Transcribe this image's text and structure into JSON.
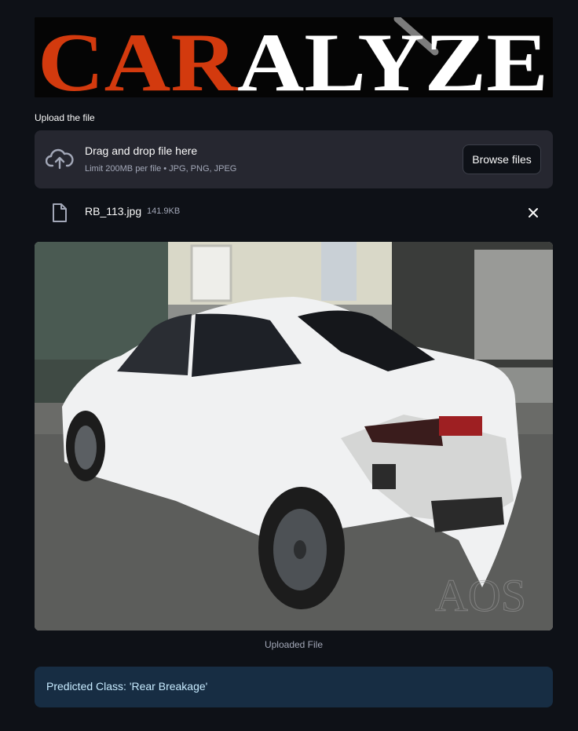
{
  "header": {
    "logo_text_left": "CAR",
    "logo_text_right": "ALYZE",
    "logo_color_left": "#d33a0e",
    "logo_color_right": "#ffffff"
  },
  "uploader": {
    "label": "Upload the file",
    "drop_title": "Drag and drop file here",
    "limit_text": "Limit 200MB per file • JPG, PNG, JPEG",
    "browse_label": "Browse files",
    "upload_icon": "cloud-upload-icon"
  },
  "uploaded_file": {
    "name": "RB_113.jpg",
    "size": "141.9KB",
    "file_icon": "file-icon",
    "remove_icon": "close-icon"
  },
  "image": {
    "caption": "Uploaded File",
    "watermark": "AOS"
  },
  "result": {
    "text": "Predicted Class: 'Rear Breakage'"
  },
  "colors": {
    "background": "#0e1117",
    "panel": "#262730",
    "info_bg": "#172d43",
    "info_text": "#c7ebff"
  }
}
